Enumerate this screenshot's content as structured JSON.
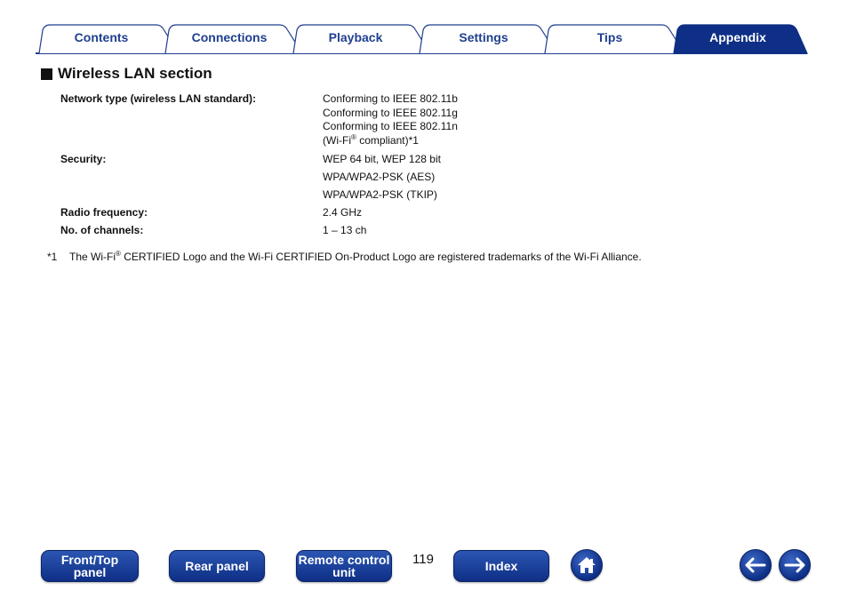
{
  "tabs": [
    {
      "label": "Contents",
      "active": false
    },
    {
      "label": "Connections",
      "active": false
    },
    {
      "label": "Playback",
      "active": false
    },
    {
      "label": "Settings",
      "active": false
    },
    {
      "label": "Tips",
      "active": false
    },
    {
      "label": "Appendix",
      "active": true
    }
  ],
  "colors": {
    "tab_text": "#1f3f8f",
    "tab_active_fill": "#0e2f85",
    "button_fill": "#0e2f85"
  },
  "section": {
    "title": "Wireless LAN section",
    "specs": [
      {
        "label": "Network type (wireless LAN standard):",
        "values": [
          "Conforming to IEEE 802.11b",
          "Conforming to IEEE 802.11g",
          "Conforming to IEEE 802.11n"
        ],
        "wifi_line": {
          "prefix": "(Wi-Fi",
          "sup": "®",
          "suffix": " compliant)",
          "note": "*1"
        }
      },
      {
        "label": "Security:",
        "values": [
          "WEP 64 bit, WEP 128 bit",
          "WPA/WPA2-PSK (AES)",
          "WPA/WPA2-PSK (TKIP)"
        ]
      },
      {
        "label": "Radio frequency:",
        "values": [
          "2.4 GHz"
        ]
      },
      {
        "label": "No. of channels:",
        "values": [
          "1 – 13 ch"
        ]
      }
    ]
  },
  "footnote": {
    "mark": "*1",
    "prefix": "The Wi-Fi",
    "sup": "®",
    "text": " CERTIFIED Logo and the Wi-Fi CERTIFIED On-Product Logo are registered trademarks of the Wi-Fi Alliance."
  },
  "bottom_nav": {
    "front_top_line1": "Front/Top",
    "front_top_line2": "panel",
    "rear_panel": "Rear panel",
    "remote_line1": "Remote control",
    "remote_line2": "unit",
    "page_number": "119",
    "index": "Index",
    "home_icon": "home-icon",
    "back_icon": "arrow-left-icon",
    "forward_icon": "arrow-right-icon"
  }
}
